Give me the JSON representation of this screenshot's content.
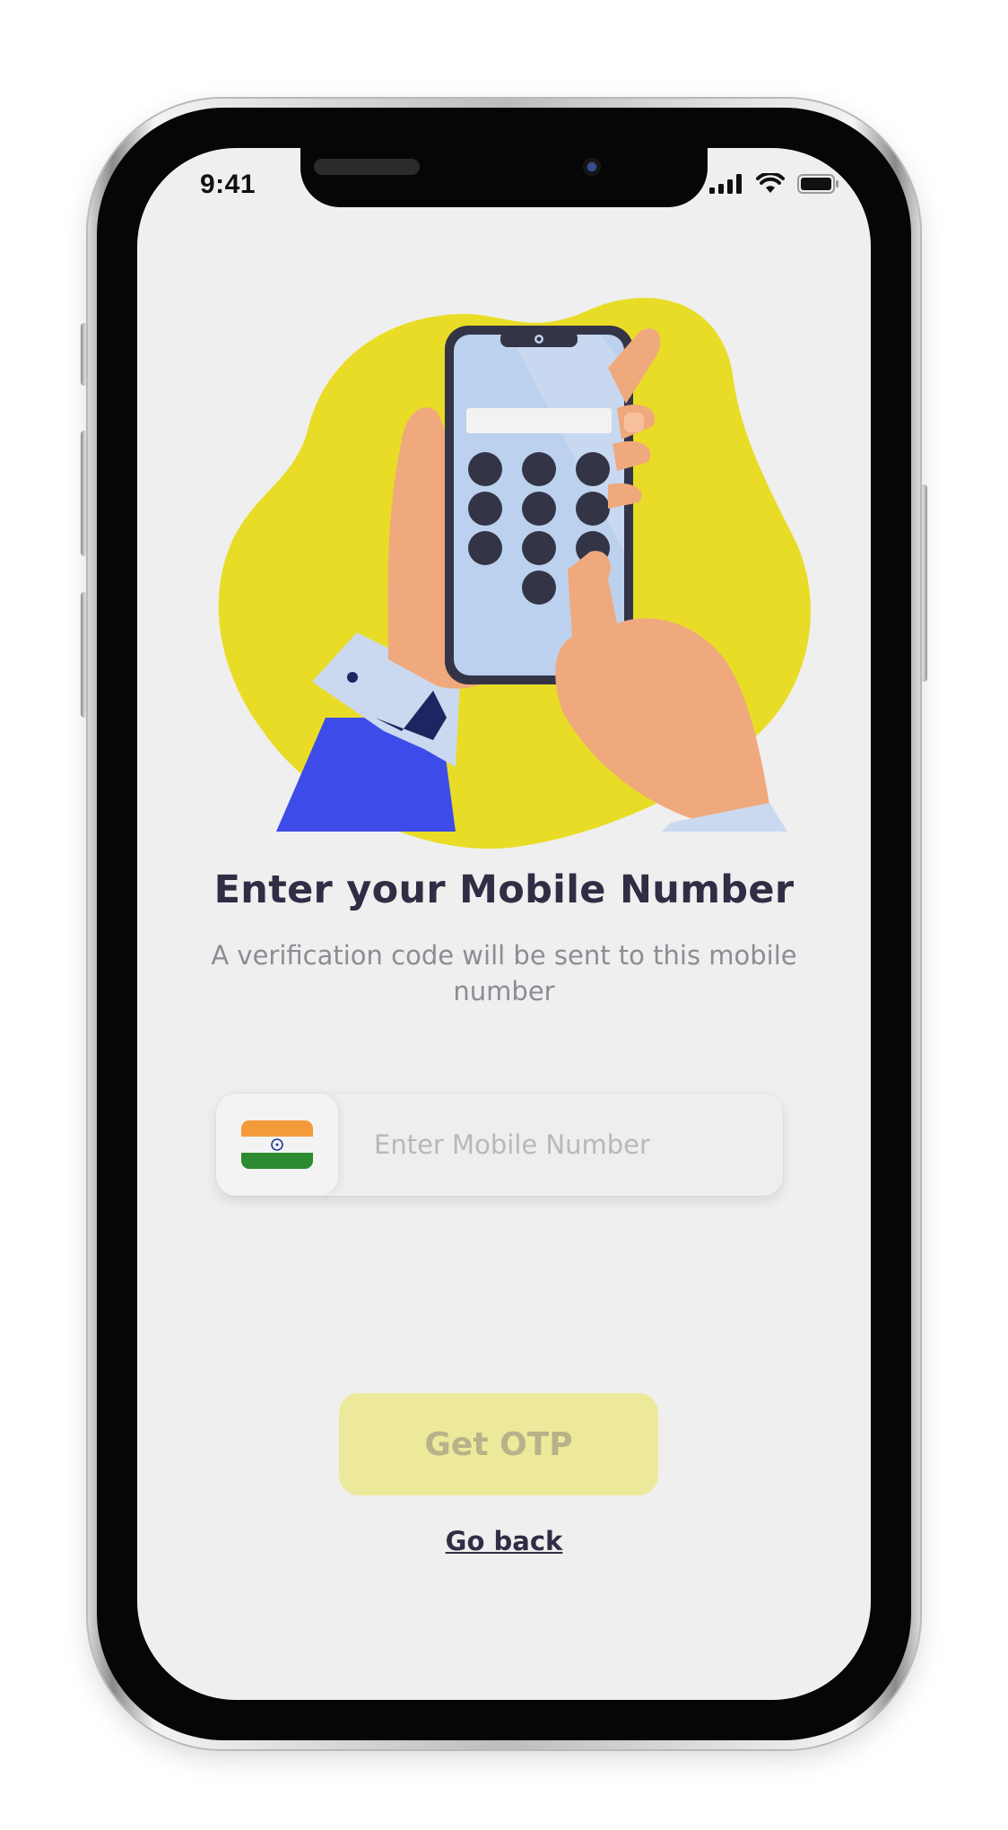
{
  "status_bar": {
    "time": "9:41",
    "icons": [
      "signal-icon",
      "wifi-icon",
      "battery-icon"
    ]
  },
  "illustration": {
    "name": "hands-holding-phone-keypad-illustration",
    "colors": {
      "blob": "#e9dc26",
      "skin": "#efa97c",
      "phone_screen": "#bcd1ed",
      "phone_frame": "#343447",
      "sleeve": "#3d4ce8",
      "cuff": "#cad9ef"
    }
  },
  "main": {
    "title": "Enter your Mobile Number",
    "subtitle": "A verification code will be sent to this mobile number"
  },
  "phone_input": {
    "country_flag": "india-flag-icon",
    "placeholder": "Enter Mobile Number",
    "value": ""
  },
  "actions": {
    "get_otp_label": "Get OTP",
    "go_back_label": "Go back"
  },
  "colors": {
    "background": "#efefef",
    "title": "#2f2e45",
    "subtitle": "#8c8c95",
    "button_disabled": "#ede99a",
    "button_text_disabled": "#b7b28a"
  }
}
